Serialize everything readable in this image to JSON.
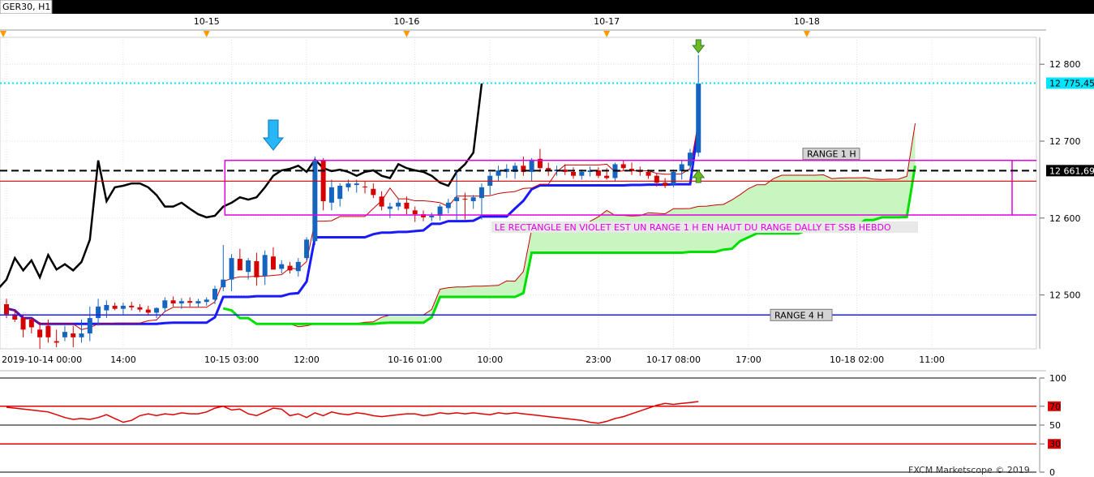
{
  "window": {
    "title": "GER30, H1"
  },
  "colors": {
    "bull": "#1565c0",
    "bear": "#d50000",
    "kijun": "#1a1aff",
    "tenkan": "#cc0000",
    "chikou": "#000000",
    "senkou_b": "#00e000",
    "cloud": "#c8f5c0",
    "range_rect": "#e000e0",
    "annotation": "#e000e0",
    "price_line": "#00e5ff",
    "rsi": "#e00000",
    "grid": "#e0e0e0"
  },
  "header": {
    "dates": [
      "10-15",
      "10-16",
      "10-17",
      "10-18"
    ]
  },
  "annotations": {
    "range_1h": "RANGE 1 H",
    "range_4h": "RANGE 4 H",
    "note": "LE RECTANGLE EN VIOLET EST UN RANGE 1 H  EN HAUT DU RANGE DALLY ET SSB HEBDO",
    "current_price": "12 775,45",
    "black_line": "12 661,69"
  },
  "footer": {
    "copyright": "FXCM Marketscope © 2019"
  },
  "chart_data": [
    {
      "type": "candlestick",
      "title": "GER30, H1",
      "ylim": [
        12430,
        12835
      ],
      "y_ticks": [
        "12 800",
        "12 700",
        "12 600",
        "12 500"
      ],
      "y_tick_values": [
        12800,
        12700,
        12600,
        12500
      ],
      "x_labels": [
        "2019-10-14 00:00",
        "14:00",
        "10-15 03:00",
        "12:00",
        "10-16 01:00",
        "10:00",
        "23:00",
        "10-17 08:00",
        "17:00",
        "10-18 02:00",
        "11:00"
      ],
      "x_label_index": [
        0,
        14,
        27,
        36,
        49,
        58,
        71,
        80,
        89,
        102,
        111
      ],
      "date_marks": [
        "10-15",
        "10-16",
        "10-17",
        "10-18"
      ],
      "date_mark_index": [
        24,
        48,
        72,
        96
      ],
      "candles": [
        [
          12488,
          12495,
          12470,
          12475
        ],
        [
          12475,
          12480,
          12465,
          12468
        ],
        [
          12470,
          12475,
          12445,
          12455
        ],
        [
          12468,
          12470,
          12450,
          12458
        ],
        [
          12455,
          12465,
          12430,
          12445
        ],
        [
          12460,
          12468,
          12438,
          12445
        ],
        [
          12440,
          12455,
          12432,
          12438
        ],
        [
          12445,
          12460,
          12440,
          12452
        ],
        [
          12450,
          12460,
          12432,
          12445
        ],
        [
          12445,
          12468,
          12438,
          12450
        ],
        [
          12450,
          12485,
          12440,
          12470
        ],
        [
          12470,
          12495,
          12460,
          12485
        ],
        [
          12480,
          12493,
          12470,
          12487
        ],
        [
          12486,
          12490,
          12480,
          12482
        ],
        [
          12482,
          12490,
          12475,
          12486
        ],
        [
          12486,
          12491,
          12480,
          12484
        ],
        [
          12484,
          12488,
          12478,
          12481
        ],
        [
          12481,
          12486,
          12473,
          12477
        ],
        [
          12477,
          12484,
          12470,
          12483
        ],
        [
          12483,
          12497,
          12478,
          12493
        ],
        [
          12493,
          12498,
          12485,
          12489
        ],
        [
          12489,
          12496,
          12482,
          12492
        ],
        [
          12492,
          12497,
          12485,
          12490
        ],
        [
          12489,
          12495,
          12484,
          12492
        ],
        [
          12491,
          12497,
          12486,
          12494
        ],
        [
          12494,
          12512,
          12488,
          12508
        ],
        [
          12510,
          12565,
          12505,
          12520
        ],
        [
          12520,
          12553,
          12505,
          12548
        ],
        [
          12547,
          12560,
          12533,
          12532
        ],
        [
          12530,
          12548,
          12520,
          12545
        ],
        [
          12544,
          12555,
          12512,
          12523
        ],
        [
          12525,
          12558,
          12513,
          12552
        ],
        [
          12550,
          12562,
          12542,
          12533
        ],
        [
          12534,
          12545,
          12528,
          12540
        ],
        [
          12538,
          12543,
          12528,
          12532
        ],
        [
          12531,
          12548,
          12524,
          12543
        ],
        [
          12548,
          12575,
          12545,
          12572
        ],
        [
          12570,
          12680,
          12565,
          12675
        ],
        [
          12675,
          12678,
          12610,
          12622
        ],
        [
          12620,
          12650,
          12610,
          12640
        ],
        [
          12625,
          12645,
          12615,
          12642
        ],
        [
          12640,
          12650,
          12635,
          12645
        ],
        [
          12643,
          12650,
          12633,
          12645
        ],
        [
          12641,
          12648,
          12632,
          12640
        ],
        [
          12638,
          12645,
          12626,
          12630
        ],
        [
          12628,
          12635,
          12610,
          12615
        ],
        [
          12612,
          12620,
          12600,
          12615
        ],
        [
          12615,
          12625,
          12610,
          12620
        ],
        [
          12620,
          12628,
          12605,
          12612
        ],
        [
          12610,
          12615,
          12595,
          12605
        ],
        [
          12605,
          12610,
          12596,
          12601
        ],
        [
          12601,
          12607,
          12596,
          12603
        ],
        [
          12603,
          12618,
          12597,
          12615
        ],
        [
          12613,
          12625,
          12606,
          12620
        ],
        [
          12622,
          12662,
          12597,
          12627
        ],
        [
          12625,
          12633,
          12598,
          12624
        ],
        [
          12622,
          12630,
          12612,
          12627
        ],
        [
          12626,
          12645,
          12598,
          12640
        ],
        [
          12642,
          12660,
          12630,
          12655
        ],
        [
          12655,
          12668,
          12648,
          12662
        ],
        [
          12660,
          12670,
          12652,
          12664
        ],
        [
          12660,
          12672,
          12651,
          12668
        ],
        [
          12668,
          12680,
          12655,
          12660
        ],
        [
          12660,
          12678,
          12648,
          12676
        ],
        [
          12677,
          12690,
          12660,
          12665
        ],
        [
          12665,
          12672,
          12655,
          12661
        ],
        [
          12661,
          12668,
          12655,
          12663
        ],
        [
          12663,
          12670,
          12656,
          12660
        ],
        [
          12660,
          12666,
          12651,
          12655
        ],
        [
          12655,
          12663,
          12650,
          12660
        ],
        [
          12660,
          12667,
          12654,
          12662
        ],
        [
          12662,
          12666,
          12652,
          12655
        ],
        [
          12655,
          12665,
          12650,
          12652
        ],
        [
          12652,
          12672,
          12648,
          12670
        ],
        [
          12670,
          12675,
          12662,
          12665
        ],
        [
          12664,
          12672,
          12656,
          12662
        ],
        [
          12662,
          12667,
          12655,
          12660
        ],
        [
          12660,
          12663,
          12651,
          12655
        ],
        [
          12655,
          12658,
          12641,
          12646
        ],
        [
          12646,
          12652,
          12639,
          12642
        ],
        [
          12644,
          12663,
          12640,
          12660
        ],
        [
          12661,
          12676,
          12650,
          12670
        ],
        [
          12668,
          12690,
          12661,
          12685
        ],
        [
          12685,
          12812,
          12680,
          12775
        ]
      ]
    },
    {
      "type": "line",
      "name": "RSI",
      "ylim": [
        0,
        100
      ],
      "levels": [
        70,
        50,
        30
      ],
      "y_ticks": [
        "100",
        "70",
        "50",
        "30",
        "0"
      ],
      "values": [
        69,
        68,
        67,
        66,
        65,
        64,
        61,
        58,
        56,
        57,
        56,
        58,
        61,
        57,
        53,
        55,
        60,
        62,
        60,
        62,
        61,
        63,
        62,
        62,
        64,
        68,
        70,
        66,
        67,
        62,
        60,
        64,
        68,
        67,
        60,
        62,
        58,
        63,
        60,
        64,
        62,
        61,
        63,
        62,
        60,
        59,
        60,
        61,
        62,
        62,
        60,
        61,
        63,
        62,
        63,
        62,
        63,
        62,
        61,
        63,
        62,
        63,
        62,
        61,
        60,
        59,
        58,
        57,
        56,
        55,
        53,
        52,
        54,
        57,
        59,
        62,
        65,
        68,
        71,
        73,
        72,
        73,
        74,
        75
      ]
    }
  ]
}
